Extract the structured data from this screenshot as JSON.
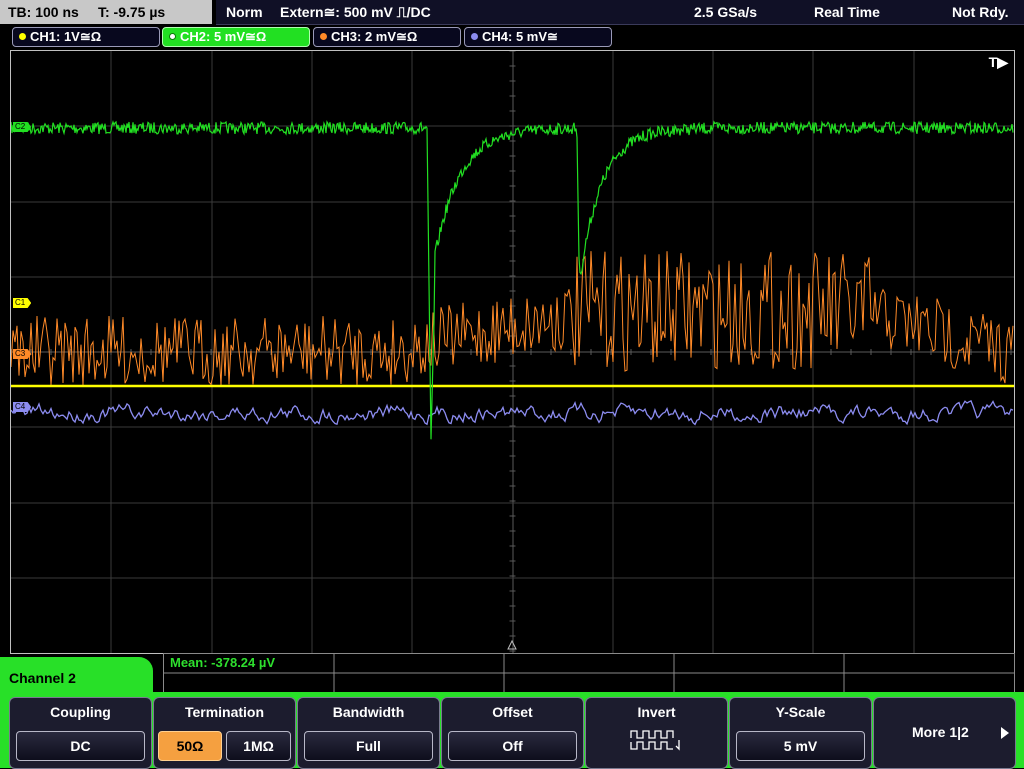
{
  "status": {
    "timebase": "TB: 100 ns",
    "trigger_time": "T: -9.75 µs",
    "mode": "Norm",
    "trigger_source": "Extern≅: 500 mV ⎍/DC",
    "sample_rate": "2.5 GSa/s",
    "acq_mode": "Real Time",
    "state": "Not Rdy."
  },
  "channels": [
    {
      "label": "CH1: 1V≅Ω",
      "color": "#ffff00"
    },
    {
      "label": "CH2: 5 mV≅Ω",
      "color": "#22e022"
    },
    {
      "label": "CH3: 2 mV≅Ω",
      "color": "#ff8a28"
    },
    {
      "label": "CH4: 5 mV≅",
      "color": "#8c8cf0"
    }
  ],
  "plot": {
    "trigger_marker": "T▶",
    "markers": {
      "c1": "C1",
      "c2": "C2",
      "c3": "C3",
      "c4": "C4"
    }
  },
  "measurement": {
    "label": "Mean: -378.24 µV"
  },
  "menu": {
    "title": "Channel 2",
    "coupling": {
      "label": "Coupling",
      "value": "DC"
    },
    "termination": {
      "label": "Termination",
      "opt1": "50Ω",
      "opt2": "1MΩ"
    },
    "bandwidth": {
      "label": "Bandwidth",
      "value": "Full"
    },
    "offset": {
      "label": "Offset",
      "value": "Off"
    },
    "invert": {
      "label": "Invert"
    },
    "yscale": {
      "label": "Y-Scale",
      "value": "5 mV"
    },
    "more": {
      "label": "More 1|2"
    }
  }
}
